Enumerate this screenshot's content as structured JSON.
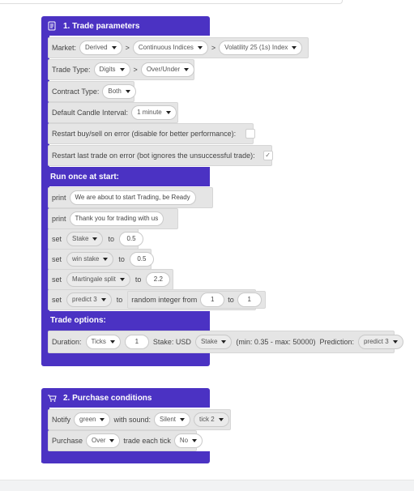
{
  "trade_parameters": {
    "title": "1. Trade parameters",
    "market": {
      "label": "Market:",
      "sep": ">",
      "values": [
        "Derived",
        "Continuous Indices",
        "Volatility 25 (1s) Index"
      ]
    },
    "trade_type": {
      "label": "Trade Type:",
      "sep": ">",
      "values": [
        "Digits",
        "Over/Under"
      ]
    },
    "contract_type": {
      "label": "Contract Type:",
      "value": "Both"
    },
    "candle_interval": {
      "label": "Default Candle Interval:",
      "value": "1 minute"
    },
    "restart_on_error": {
      "label": "Restart buy/sell on error (disable for better performance):",
      "checked": ""
    },
    "restart_last_trade": {
      "label": "Restart last trade on error (bot ignores the unsuccessful trade):",
      "checked": "✓"
    }
  },
  "run_once": {
    "title": "Run once at start:",
    "print1": {
      "kw": "print",
      "text": "We are about to start Trading, be Ready"
    },
    "print2": {
      "kw": "print",
      "text": "Thank you for trading with us"
    },
    "set1": {
      "kw": "set",
      "var": "Stake",
      "to": "to",
      "value": "0.5"
    },
    "set2": {
      "kw": "set",
      "var": "win stake",
      "to": "to",
      "value": "0.5"
    },
    "set3": {
      "kw": "set",
      "var": "Martingale split",
      "to": "to",
      "value": "2.2"
    },
    "set4": {
      "kw": "set",
      "var": "predict 3",
      "to": "to",
      "random_label": "random integer from",
      "from": "1",
      "to2": "to",
      "max": "1"
    }
  },
  "trade_options": {
    "title": "Trade options:",
    "duration_label": "Duration:",
    "duration_unit": "Ticks",
    "duration_value": "1",
    "stake_label": "Stake: USD",
    "stake_var": "Stake",
    "range_text": "(min: 0.35 - max: 50000)",
    "prediction_label": "Prediction:",
    "prediction_var": "predict 3"
  },
  "purchase_conditions": {
    "title": "2. Purchase conditions",
    "notify": {
      "kw": "Notify",
      "color": "green",
      "sound_label": "with sound:",
      "sound": "Silent",
      "tick": "tick 2"
    },
    "purchase": {
      "kw": "Purchase",
      "type": "Over",
      "label": "trade each tick",
      "each_tick": "No"
    }
  },
  "colors": {
    "block_purple": "#4b32c3",
    "block_gray": "#e5e5e5",
    "strip": "#f2f3f4"
  }
}
